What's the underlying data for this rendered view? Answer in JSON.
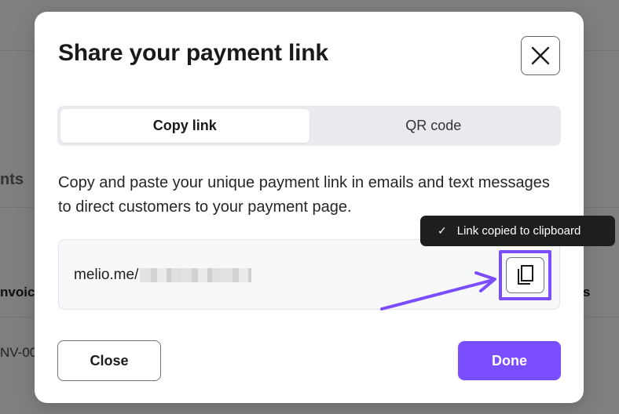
{
  "background": {
    "tabs_fragment": "nts",
    "invoice_header": "nvoice",
    "invoice_row": "NV-00",
    "right_header_fragment": "s"
  },
  "modal": {
    "title": "Share your payment link",
    "close_icon": "close-icon",
    "tabs": [
      {
        "label": "Copy link",
        "active": true
      },
      {
        "label": "QR code",
        "active": false
      }
    ],
    "description": "Copy and paste your unique payment link in emails and text messages to direct customers to your payment page.",
    "link": {
      "prefix": "melio.me/",
      "copy_icon": "copy-icon"
    },
    "tooltip": {
      "icon": "check-icon",
      "text": "Link copied to clipboard"
    },
    "buttons": {
      "close_label": "Close",
      "done_label": "Done"
    }
  },
  "colors": {
    "accent": "#7a4dff",
    "annotation": "#7b4dff",
    "tooltip_bg": "#1e1e1e"
  }
}
